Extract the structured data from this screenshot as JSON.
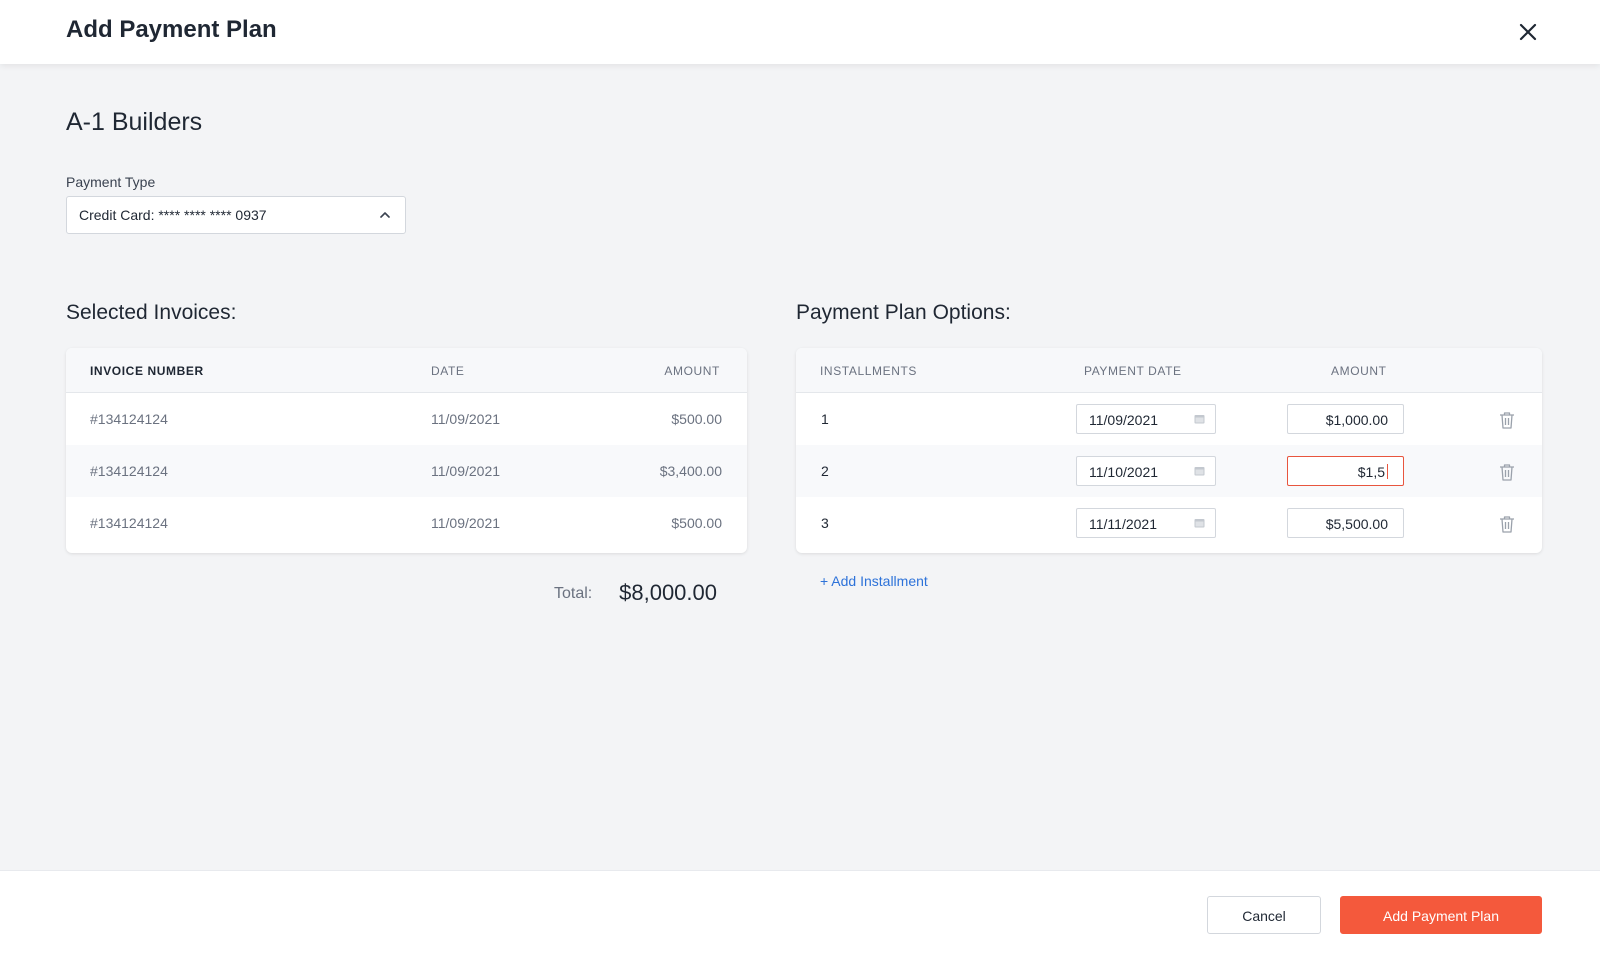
{
  "modal": {
    "title": "Add Payment Plan",
    "close_icon": "close-icon"
  },
  "company": {
    "name": "A-1 Builders"
  },
  "payment_type": {
    "label": "Payment Type",
    "value": "Credit Card: **** **** **** 0937",
    "icon": "chevron-up-icon"
  },
  "invoices": {
    "title": "Selected Invoices:",
    "columns": [
      "INVOICE NUMBER",
      "DATE",
      "AMOUNT"
    ],
    "rows": [
      {
        "number": "#134124124",
        "date": "11/09/2021",
        "amount": "$500.00"
      },
      {
        "number": "#134124124",
        "date": "11/09/2021",
        "amount": "$3,400.00"
      },
      {
        "number": "#134124124",
        "date": "11/09/2021",
        "amount": "$500.00"
      }
    ],
    "total_label": "Total:",
    "total_value": "$8,000.00"
  },
  "plan": {
    "title": "Payment Plan Options:",
    "columns": [
      "INSTALLMENTS",
      "PAYMENT DATE",
      "AMOUNT"
    ],
    "rows": [
      {
        "installment": "1",
        "date": "11/09/2021",
        "amount": "$1,000.00",
        "editing": false
      },
      {
        "installment": "2",
        "date": "11/10/2021",
        "amount": "$1,5",
        "editing": true
      },
      {
        "installment": "3",
        "date": "11/11/2021",
        "amount": "$5,500.00",
        "editing": false
      }
    ],
    "add_label": "+ Add Installment",
    "icons": {
      "date": "calendar-icon",
      "delete": "trash-icon"
    }
  },
  "footer": {
    "cancel_label": "Cancel",
    "submit_label": "Add Payment Plan"
  },
  "colors": {
    "accent": "#f4593c",
    "link": "#2d72d9",
    "error_border": "#e8553e",
    "background": "#f3f4f6"
  }
}
